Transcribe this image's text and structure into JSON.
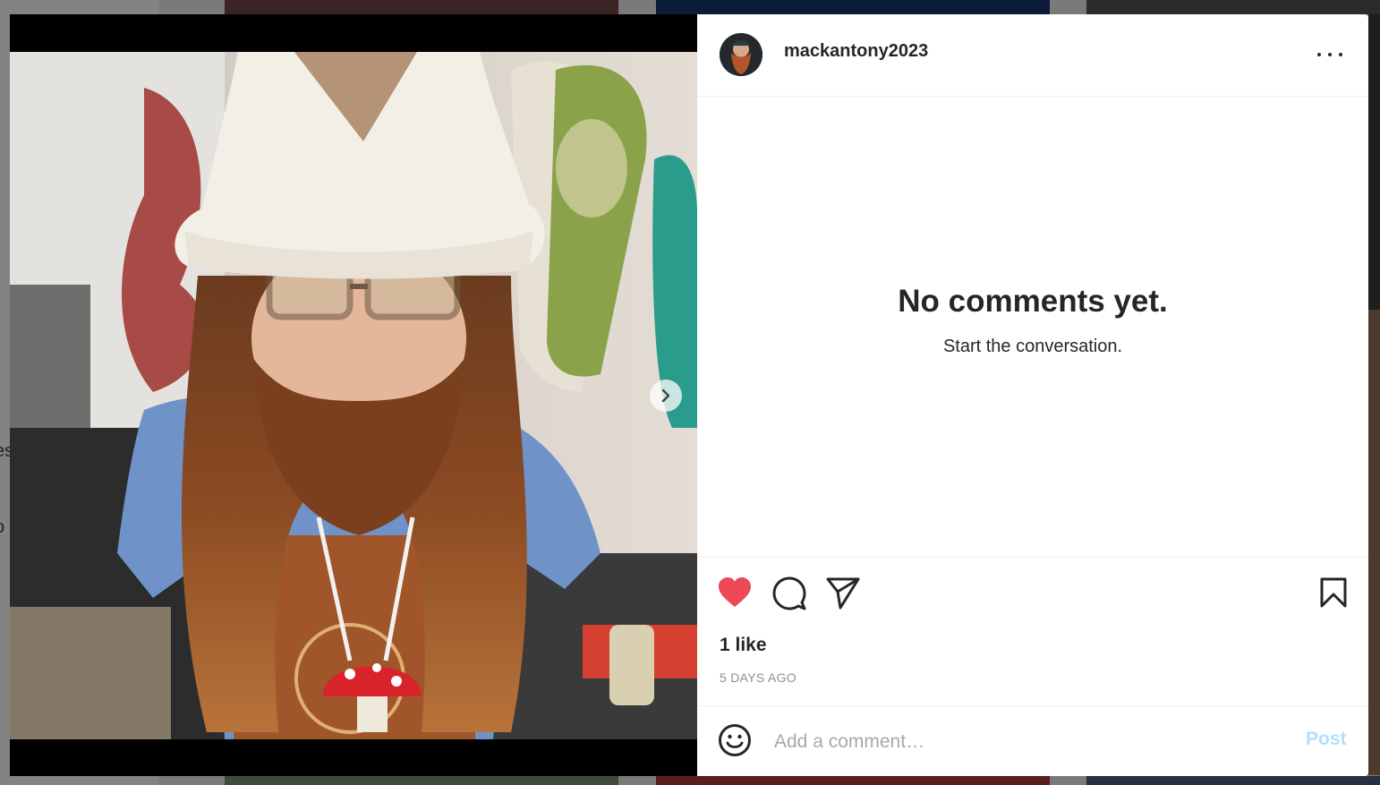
{
  "post": {
    "username": "mackantony2023",
    "empty_title": "No comments yet.",
    "empty_subtitle": "Start the conversation.",
    "likes": "1 like",
    "timestamp": "5 DAYS AGO",
    "liked": true,
    "carousel_index": 1
  },
  "comment": {
    "placeholder": "Add a comment…",
    "post_label": "Post"
  },
  "icons": {
    "more": "more-options-icon",
    "like": "heart-icon",
    "comment": "comment-icon",
    "share": "send-icon",
    "save": "bookmark-icon",
    "emoji": "emoji-icon",
    "next": "chevron-right-icon"
  },
  "background": {
    "side_text": [
      "es",
      "o"
    ]
  },
  "colors": {
    "like": "#ed4956",
    "post_disabled": "#b2dffc",
    "text": "#262626",
    "muted": "#8e8e8e"
  }
}
